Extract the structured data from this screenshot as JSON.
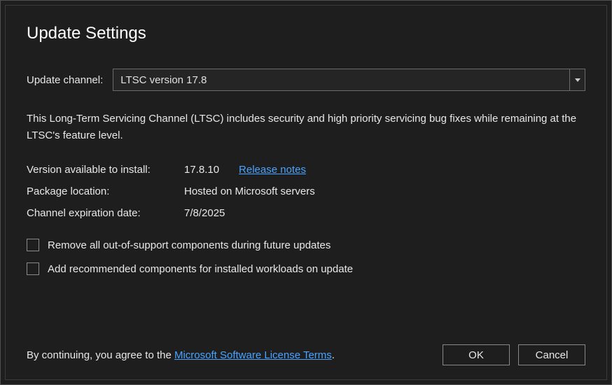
{
  "title": "Update Settings",
  "channel": {
    "label": "Update channel:",
    "selected": "LTSC version 17.8"
  },
  "description": "This Long-Term Servicing Channel (LTSC) includes security and high priority servicing bug fixes while remaining at the LTSC's feature level.",
  "info": {
    "version_label": "Version available to install:",
    "version_value": "17.8.10",
    "release_notes_link": "Release notes",
    "package_label": "Package location:",
    "package_value": "Hosted on Microsoft servers",
    "expiration_label": "Channel expiration date:",
    "expiration_value": "7/8/2025"
  },
  "options": {
    "remove_unsupported": {
      "label": "Remove all out-of-support components during future updates",
      "checked": false
    },
    "add_recommended": {
      "label": "Add recommended components for installed workloads on update",
      "checked": false
    }
  },
  "footer": {
    "prefix": "By continuing, you agree to the ",
    "license_link": "Microsoft Software License Terms",
    "suffix": ".",
    "ok": "OK",
    "cancel": "Cancel"
  }
}
